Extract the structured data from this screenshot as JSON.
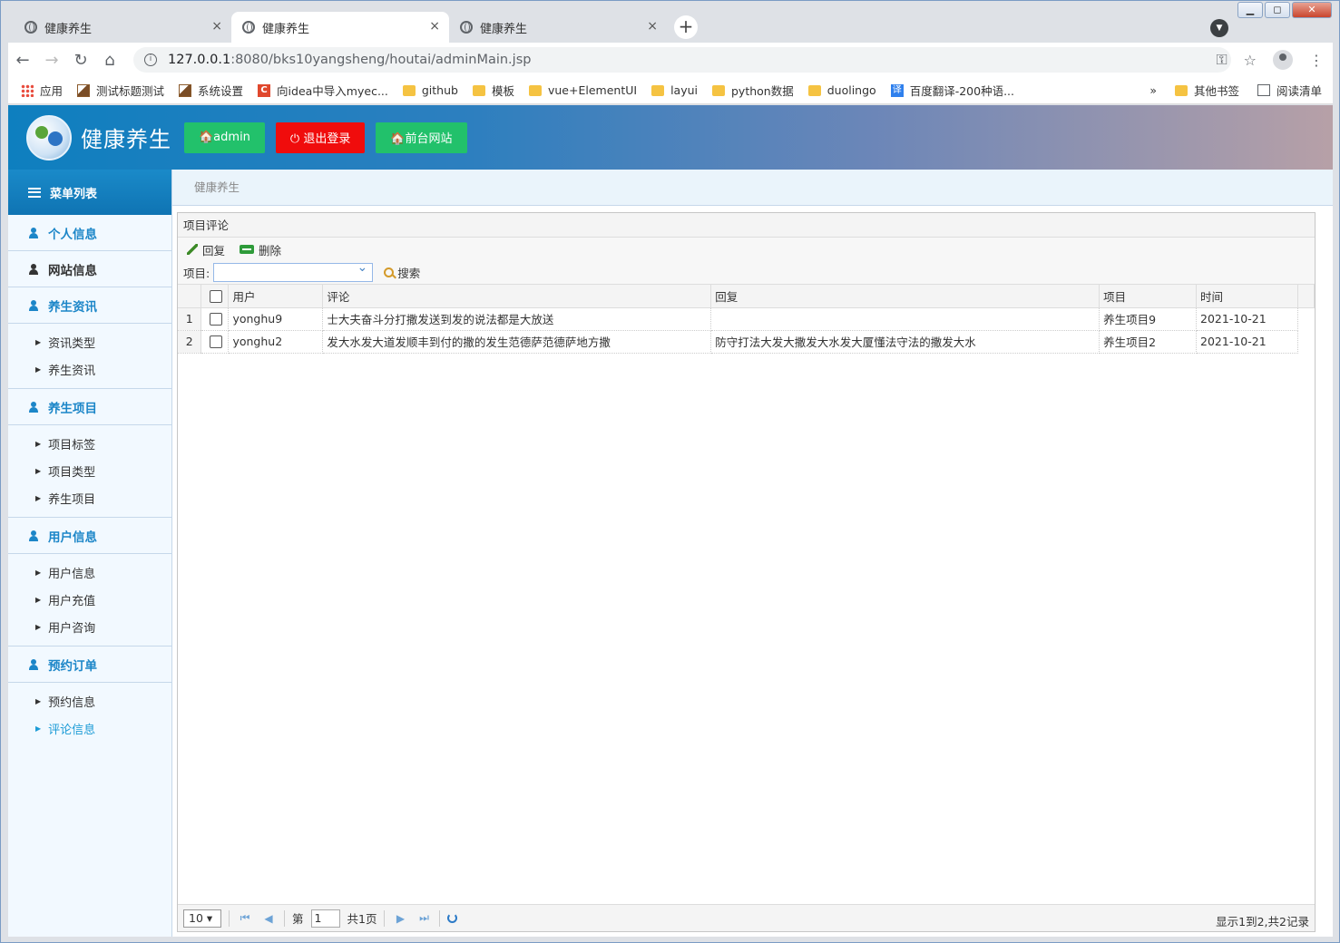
{
  "browser": {
    "tabs": [
      {
        "title": "健康养生",
        "close": "×"
      },
      {
        "title": "健康养生",
        "close": "×"
      },
      {
        "title": "健康养生",
        "close": "×"
      }
    ],
    "new_tab": "+",
    "url_host": "127.0.0.1",
    "url_rest": ":8080/bks10yangsheng/houtai/adminMain.jsp",
    "window_controls": [
      "▁",
      "◻",
      "✕"
    ],
    "bookmarks": [
      {
        "label": "应用",
        "icon": "apps-icon"
      },
      {
        "label": "测试标题测试",
        "icon": "image-icon"
      },
      {
        "label": "系统设置",
        "icon": "image-icon"
      },
      {
        "label": "向idea中导入myec...",
        "icon": "c-icon"
      },
      {
        "label": "github",
        "icon": "folder-icon"
      },
      {
        "label": "模板",
        "icon": "folder-icon"
      },
      {
        "label": "vue+ElementUI",
        "icon": "folder-icon"
      },
      {
        "label": "layui",
        "icon": "folder-icon"
      },
      {
        "label": "python数据",
        "icon": "folder-icon"
      },
      {
        "label": "duolingo",
        "icon": "folder-icon"
      },
      {
        "label": "百度翻译-200种语...",
        "icon": "translate-icon"
      }
    ],
    "bookmarks_more": "»",
    "other_bookmarks": "其他书签",
    "reading_list": "阅读清单"
  },
  "header": {
    "title": "健康养生",
    "buttons": [
      {
        "label": "🏠admin",
        "color": "#22c16b"
      },
      {
        "label": "⏻ 退出登录",
        "color": "#f00c0c"
      },
      {
        "label": "🏠前台网站",
        "color": "#22c16b"
      }
    ]
  },
  "sidebar": {
    "title": "菜单列表",
    "groups": [
      {
        "label": "个人信息",
        "items": []
      },
      {
        "label": "网站信息",
        "items": []
      },
      {
        "label": "养生资讯",
        "items": [
          "资讯类型",
          "养生资讯"
        ]
      },
      {
        "label": "养生项目",
        "items": [
          "项目标签",
          "项目类型",
          "养生项目"
        ]
      },
      {
        "label": "用户信息",
        "items": [
          "用户信息",
          "用户充值",
          "用户咨询"
        ]
      },
      {
        "label": "预约订单",
        "items": [
          "预约信息",
          "评论信息"
        ]
      }
    ]
  },
  "breadcrumb": "健康养生",
  "panel": {
    "title": "项目评论",
    "tools": {
      "reply": "回复",
      "delete": "删除"
    },
    "filter_label": "项目:",
    "search_label": "搜索",
    "columns": [
      "用户",
      "评论",
      "回复",
      "项目",
      "时间"
    ],
    "rows": [
      {
        "num": "1",
        "user": "yonghu9",
        "comment": "士大夫奋斗分打撒发送到发的说法都是大放送",
        "reply": "",
        "project": "养生项目9",
        "time": "2021-10-21"
      },
      {
        "num": "2",
        "user": "yonghu2",
        "comment": "发大水发大道发顺丰到付的撒的发生范德萨范德萨地方撒",
        "reply": "防守打法大发大撒发大水发大厦懂法守法的撒发大水",
        "project": "养生项目2",
        "time": "2021-10-21"
      }
    ]
  },
  "pager": {
    "page_size": "10",
    "page_prefix": "第",
    "page_num": "1",
    "page_total": "共1页",
    "info": "显示1到2,共2记录"
  }
}
